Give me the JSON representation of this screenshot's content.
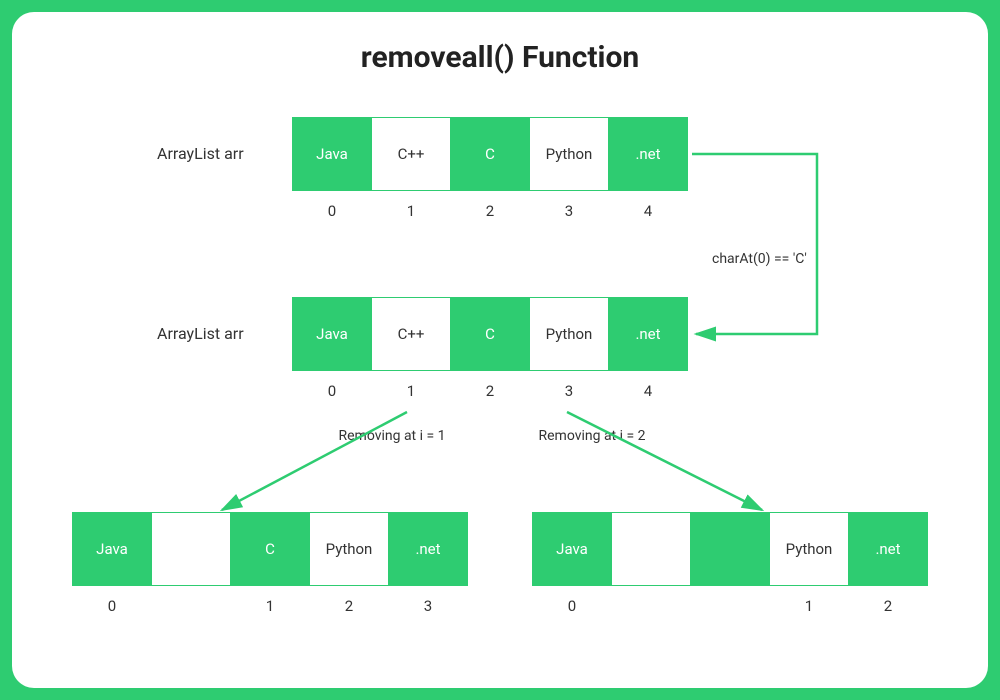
{
  "title": "removeall() Function",
  "row1": {
    "label": "ArrayList arr",
    "cells": [
      {
        "text": "Java",
        "filled": true
      },
      {
        "text": "C++",
        "filled": false
      },
      {
        "text": "C",
        "filled": true
      },
      {
        "text": "Python",
        "filled": false
      },
      {
        "text": ".net",
        "filled": true
      }
    ],
    "indices": [
      "0",
      "1",
      "2",
      "3",
      "4"
    ]
  },
  "condition": "charAt(0) == 'C'",
  "row2": {
    "label": "ArrayList arr",
    "cells": [
      {
        "text": "Java",
        "filled": true
      },
      {
        "text": "C++",
        "filled": false
      },
      {
        "text": "C",
        "filled": true
      },
      {
        "text": "Python",
        "filled": false
      },
      {
        "text": ".net",
        "filled": true
      }
    ],
    "indices": [
      "0",
      "1",
      "2",
      "3",
      "4"
    ]
  },
  "removing1": "Removing\nat i = 1",
  "removing2": "Removing\nat i = 2",
  "result1": {
    "cells": [
      {
        "text": "Java",
        "filled": true
      },
      {
        "text": "",
        "filled": false
      },
      {
        "text": "C",
        "filled": true
      },
      {
        "text": "Python",
        "filled": false
      },
      {
        "text": ".net",
        "filled": true
      }
    ],
    "indices": [
      "0",
      "",
      "1",
      "2",
      "3"
    ]
  },
  "result2": {
    "cells": [
      {
        "text": "Java",
        "filled": true
      },
      {
        "text": "",
        "filled": false
      },
      {
        "text": "",
        "filled": true
      },
      {
        "text": "Python",
        "filled": false
      },
      {
        "text": ".net",
        "filled": true
      }
    ],
    "indices": [
      "0",
      "",
      "",
      "1",
      "2"
    ]
  },
  "colors": {
    "accent": "#2ECC71"
  }
}
